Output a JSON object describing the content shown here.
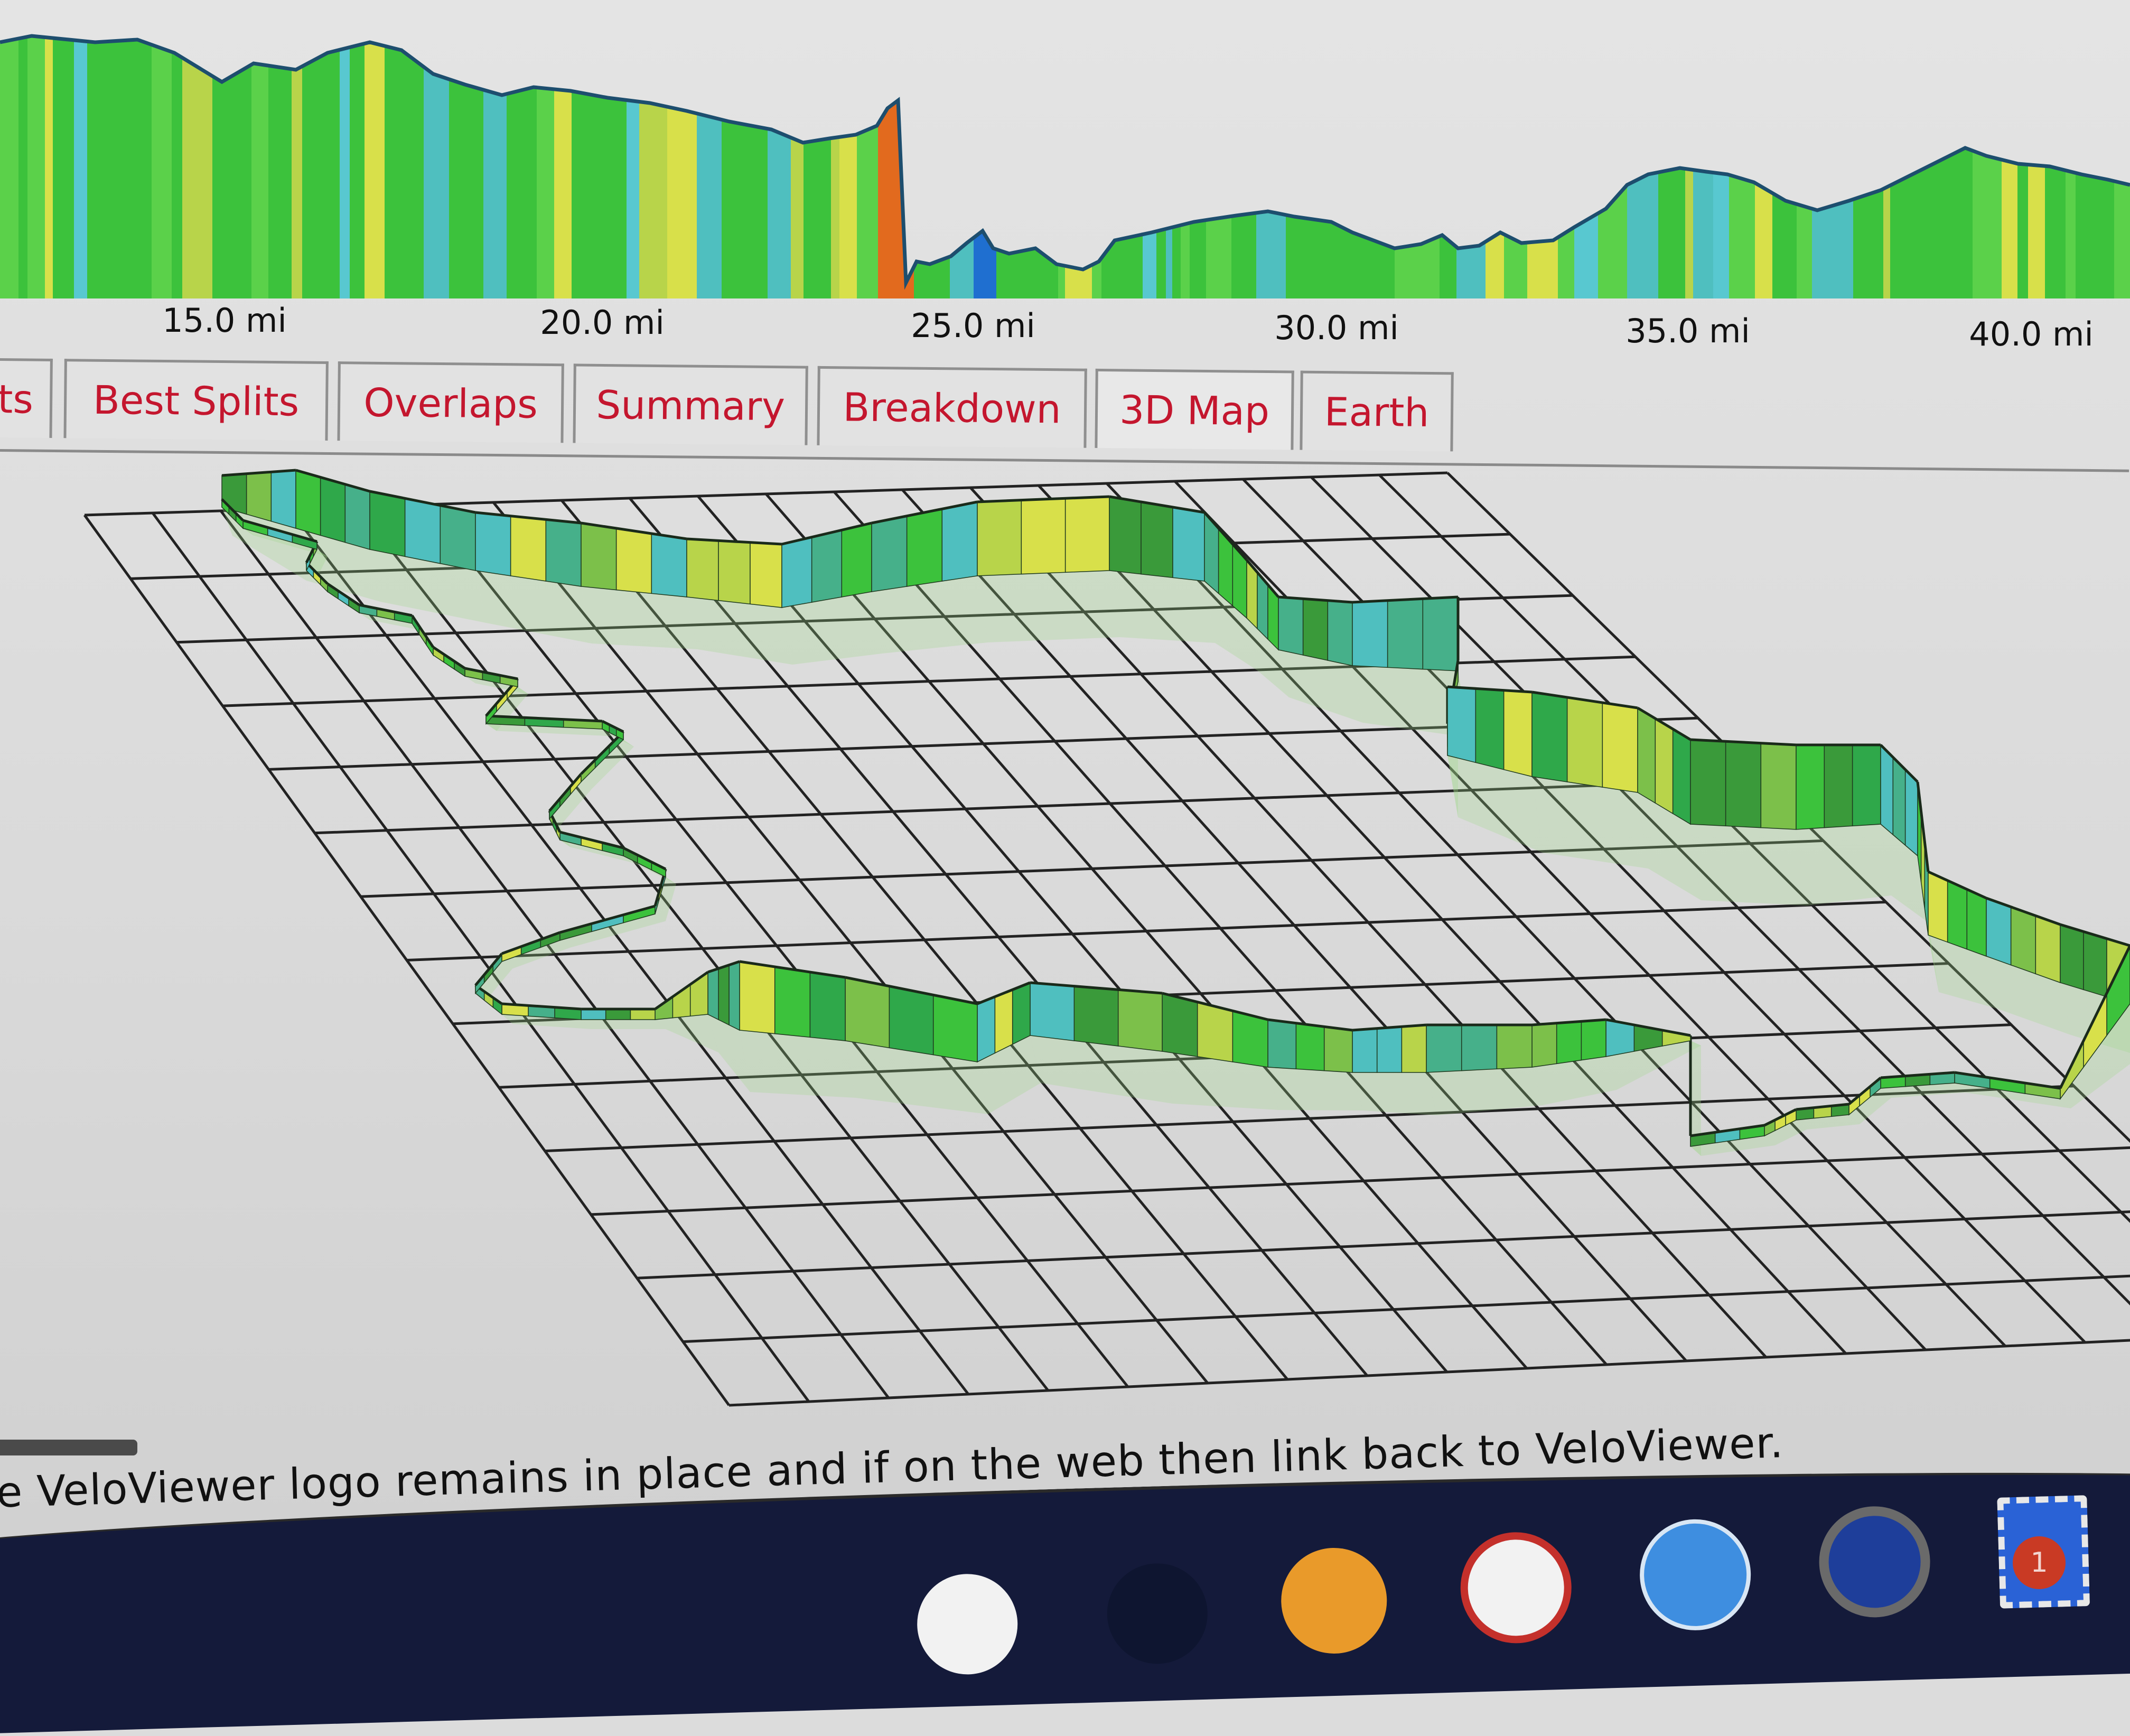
{
  "elevation_profile": {
    "x_axis_labels": [
      "15.0 mi",
      "20.0 mi",
      "25.0 mi",
      "30.0 mi",
      "35.0 mi",
      "40.0 mi"
    ],
    "x_axis_unit": "mi",
    "gradient_colors": [
      "#3cc23c",
      "#5bd14a",
      "#4fbfbf",
      "#58c8d0",
      "#d8e04a",
      "#b8d44a",
      "#2fa84a",
      "#e26a1e",
      "#0e1a3a",
      "#1f6fd0"
    ]
  },
  "tabs": [
    {
      "label": "ts",
      "active": false
    },
    {
      "label": "Best Splits",
      "active": false
    },
    {
      "label": "Overlaps",
      "active": false
    },
    {
      "label": "Summary",
      "active": false
    },
    {
      "label": "Breakdown",
      "active": false
    },
    {
      "label": "3D Map",
      "active": true
    },
    {
      "label": "Earth",
      "active": false
    }
  ],
  "map3d": {
    "description": "3D route ribbon over grid, colored by gradient"
  },
  "footer": {
    "text": "ne VeloViewer logo remains in place and if on the web then link back to VeloViewer."
  },
  "dock": {
    "notification_badge": "1"
  },
  "colors": {
    "tab_text": "#c4162e",
    "tab_border": "#8f8f8f",
    "profile_outline": "#1d4e6e",
    "grid_line": "#222222"
  }
}
